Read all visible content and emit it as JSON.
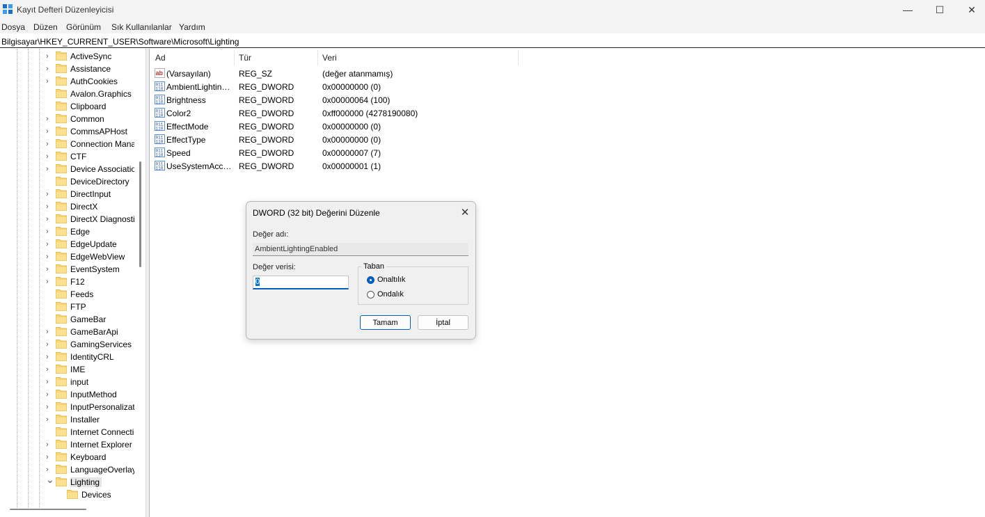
{
  "window": {
    "title": "Kayıt Defteri Düzenleyicisi",
    "minimize_icon": "minimize-icon",
    "maximize_icon": "maximize-icon",
    "close_icon": "close-icon"
  },
  "menu": [
    "Dosya",
    "Düzen",
    "Görünüm",
    "Sık Kullanılanlar",
    "Yardım"
  ],
  "address": "Bilgisayar\\HKEY_CURRENT_USER\\Software\\Microsoft\\Lighting",
  "tree": {
    "items": [
      {
        "label": "ActiveSync",
        "expandable": true
      },
      {
        "label": "Assistance",
        "expandable": true
      },
      {
        "label": "AuthCookies",
        "expandable": true
      },
      {
        "label": "Avalon.Graphics",
        "expandable": false
      },
      {
        "label": "Clipboard",
        "expandable": false
      },
      {
        "label": "Common",
        "expandable": true
      },
      {
        "label": "CommsAPHost",
        "expandable": true
      },
      {
        "label": "Connection Manager",
        "expandable": true
      },
      {
        "label": "CTF",
        "expandable": true
      },
      {
        "label": "Device Association Framework",
        "expandable": true
      },
      {
        "label": "DeviceDirectory",
        "expandable": false
      },
      {
        "label": "DirectInput",
        "expandable": true
      },
      {
        "label": "DirectX",
        "expandable": true
      },
      {
        "label": "DirectX Diagnostic Tool",
        "expandable": true
      },
      {
        "label": "Edge",
        "expandable": true
      },
      {
        "label": "EdgeUpdate",
        "expandable": true
      },
      {
        "label": "EdgeWebView",
        "expandable": true
      },
      {
        "label": "EventSystem",
        "expandable": true
      },
      {
        "label": "F12",
        "expandable": true
      },
      {
        "label": "Feeds",
        "expandable": false
      },
      {
        "label": "FTP",
        "expandable": false
      },
      {
        "label": "GameBar",
        "expandable": false
      },
      {
        "label": "GameBarApi",
        "expandable": true
      },
      {
        "label": "GamingServices",
        "expandable": true
      },
      {
        "label": "IdentityCRL",
        "expandable": true
      },
      {
        "label": "IME",
        "expandable": true
      },
      {
        "label": "input",
        "expandable": true
      },
      {
        "label": "InputMethod",
        "expandable": true
      },
      {
        "label": "InputPersonalization",
        "expandable": true
      },
      {
        "label": "Installer",
        "expandable": true
      },
      {
        "label": "Internet Connection Wizard",
        "expandable": false
      },
      {
        "label": "Internet Explorer",
        "expandable": true
      },
      {
        "label": "Keyboard",
        "expandable": true
      },
      {
        "label": "LanguageOverlay",
        "expandable": true
      },
      {
        "label": "Lighting",
        "expandable": true,
        "expanded": true,
        "selected": true
      }
    ],
    "child": {
      "label": "Devices"
    }
  },
  "columns": {
    "name": "Ad",
    "type": "Tür",
    "data": "Veri"
  },
  "values": [
    {
      "name": "(Varsayılan)",
      "type": "REG_SZ",
      "data": "(değer atanmamış)",
      "icon": "string-value-icon"
    },
    {
      "name": "AmbientLightingEnabled",
      "type": "REG_DWORD",
      "data": "0x00000000 (0)",
      "icon": "binary-value-icon"
    },
    {
      "name": "Brightness",
      "type": "REG_DWORD",
      "data": "0x00000064 (100)",
      "icon": "binary-value-icon"
    },
    {
      "name": "Color2",
      "type": "REG_DWORD",
      "data": "0xff000000 (4278190080)",
      "icon": "binary-value-icon"
    },
    {
      "name": "EffectMode",
      "type": "REG_DWORD",
      "data": "0x00000000 (0)",
      "icon": "binary-value-icon"
    },
    {
      "name": "EffectType",
      "type": "REG_DWORD",
      "data": "0x00000000 (0)",
      "icon": "binary-value-icon"
    },
    {
      "name": "Speed",
      "type": "REG_DWORD",
      "data": "0x00000007 (7)",
      "icon": "binary-value-icon"
    },
    {
      "name": "UseSystemAccentColor",
      "type": "REG_DWORD",
      "data": "0x00000001 (1)",
      "icon": "binary-value-icon"
    }
  ],
  "dialog": {
    "title": "DWORD (32 bit) Değerini Düzenle",
    "name_label": "Değer adı:",
    "name_value": "AmbientLightingEnabled",
    "data_label": "Değer verisi:",
    "data_value": "0",
    "base_label": "Taban",
    "hex_label": "Onaltılık",
    "dec_label": "Ondalık",
    "selected_base": "hex",
    "ok_label": "Tamam",
    "cancel_label": "İptal"
  },
  "colors": {
    "accent": "#005fb8",
    "folder": "#f8d775",
    "selection": "#e5e5e5"
  }
}
